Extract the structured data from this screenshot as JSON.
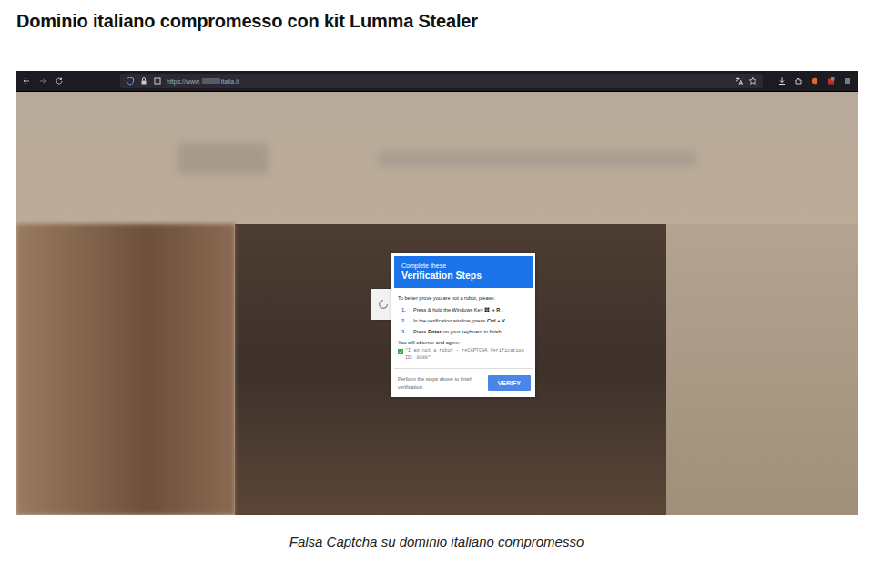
{
  "heading": "Dominio italiano compromesso con kit Lumma Stealer",
  "browser": {
    "url_prefix": "https://www.",
    "url_suffix": "italia.it"
  },
  "dialog": {
    "header_small": "Complete these",
    "header_title": "Verification Steps",
    "intro": "To better prove you are not a robot, please:",
    "steps": [
      {
        "number": "1.",
        "parts": [
          {
            "kind": "text",
            "text": "Press & hold the Windows Key",
            "bold": false
          },
          {
            "kind": "icon",
            "text": "",
            "bold": false
          },
          {
            "kind": "text",
            "text": "+ R",
            "bold": true
          },
          {
            "kind": "text",
            "text": ".",
            "bold": false
          }
        ]
      },
      {
        "number": "2.",
        "parts": [
          {
            "kind": "text",
            "text": "In the verification window, press",
            "bold": false
          },
          {
            "kind": "text",
            "text": "Ctrl + V",
            "bold": true
          },
          {
            "kind": "text",
            "text": ".",
            "bold": false
          }
        ]
      },
      {
        "number": "3.",
        "parts": [
          {
            "kind": "text",
            "text": "Press",
            "bold": false
          },
          {
            "kind": "text",
            "text": "Enter",
            "bold": true
          },
          {
            "kind": "text",
            "text": "on your keyboard to finish.",
            "bold": false
          }
        ]
      }
    ],
    "observe_label": "You will observe and agree:",
    "observe_text": "\"I am not a robot - reCAPTCHA Verification ID: 8888\"",
    "checked": true,
    "footer_text": "Perform the steps above to finish verification.",
    "button": "VERIFY"
  },
  "caption": "Falsa Captcha su dominio italiano compromesso"
}
